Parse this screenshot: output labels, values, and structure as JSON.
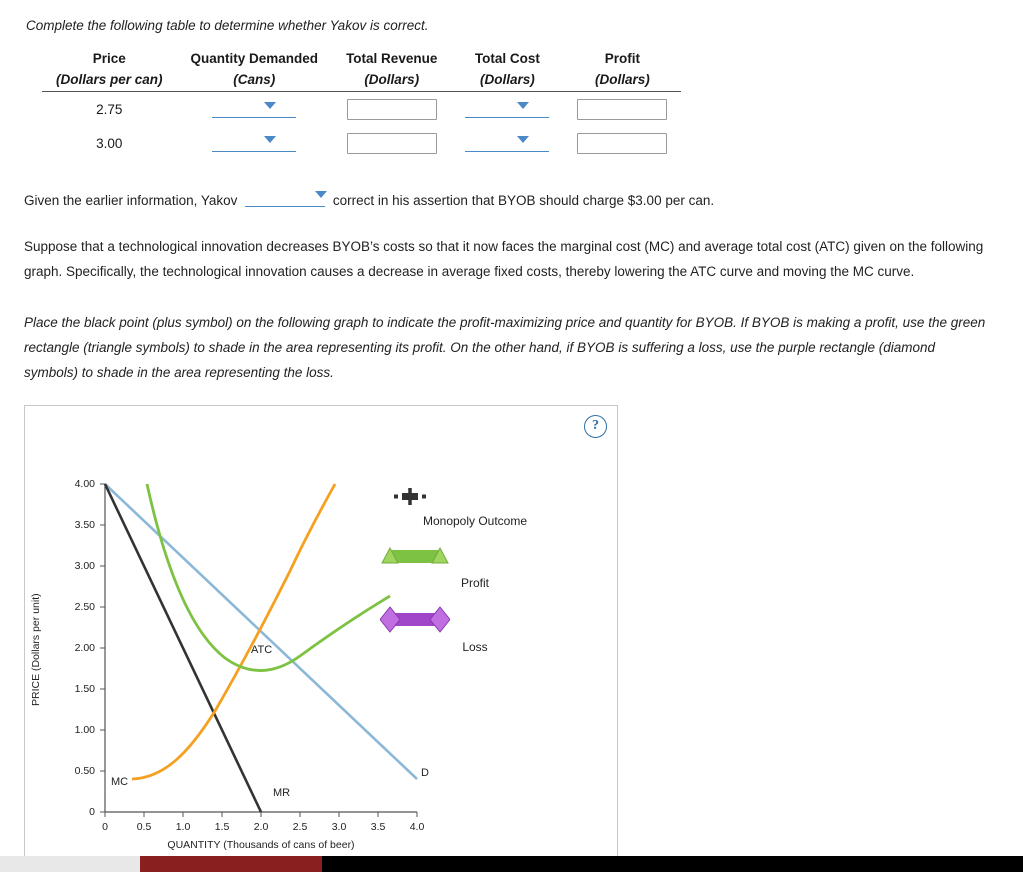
{
  "intro": "Complete the following table to determine whether Yakov is correct.",
  "table": {
    "headers": [
      {
        "title": "Price",
        "sub": "(Dollars per can)"
      },
      {
        "title": "Quantity Demanded",
        "sub": "(Cans)"
      },
      {
        "title": "Total Revenue",
        "sub": "(Dollars)"
      },
      {
        "title": "Total Cost",
        "sub": "(Dollars)"
      },
      {
        "title": "Profit",
        "sub": "(Dollars)"
      }
    ],
    "rows": [
      {
        "price": "2.75",
        "quantity": "",
        "total_revenue": "",
        "total_cost": "",
        "profit": ""
      },
      {
        "price": "3.00",
        "quantity": "",
        "total_revenue": "",
        "total_cost": "",
        "profit": ""
      }
    ]
  },
  "assertion": {
    "before": "Given the earlier information, Yakov",
    "dropdown_value": "",
    "after": "correct in his assertion that BYOB should charge $3.00 per can."
  },
  "paragraph1": "Suppose that a technological innovation decreases BYOB’s costs so that it now faces the marginal cost (MC) and average total cost (ATC) given on the following graph. Specifically, the technological innovation causes a decrease in average fixed costs, thereby lowering the ATC curve and moving the MC curve.",
  "paragraph2": "Place the black point (plus symbol) on the following graph to indicate the profit-maximizing price and quantity for BYOB. If BYOB is making a profit, use the green rectangle (triangle symbols) to shade in the area representing its profit. On the other hand, if BYOB is suffering a loss, use the purple rectangle (diamond symbols) to shade in the area representing the loss.",
  "graph_panel": {
    "help_label": "?",
    "legend": [
      {
        "name": "Monopoly Outcome",
        "color": "#333333",
        "symbol": "plus"
      },
      {
        "name": "Profit",
        "color": "#7dc242",
        "symbol": "triangle"
      },
      {
        "name": "Loss",
        "color": "#a046c8",
        "symbol": "diamond"
      }
    ]
  },
  "chart_data": {
    "type": "line",
    "title": "",
    "xlabel": "QUANTITY (Thousands of cans of beer)",
    "ylabel": "PRICE (Dollars per unit)",
    "xlim": [
      0,
      4.0
    ],
    "ylim": [
      0,
      4.0
    ],
    "xticks": [
      "0",
      "0.5",
      "1.0",
      "1.5",
      "2.0",
      "2.5",
      "3.0",
      "3.5",
      "4.0"
    ],
    "yticks": [
      "0",
      "0.50",
      "1.00",
      "1.50",
      "2.00",
      "2.50",
      "3.00",
      "3.50",
      "4.00"
    ],
    "grid": false,
    "series": [
      {
        "name": "D",
        "label": "D",
        "color": "#8cb8d8",
        "points": [
          [
            0,
            4.0
          ],
          [
            4.0,
            0.4
          ]
        ]
      },
      {
        "name": "MR",
        "label": "MR",
        "color": "#333333",
        "points": [
          [
            0,
            4.0
          ],
          [
            2.0,
            0.0
          ]
        ]
      },
      {
        "name": "MC",
        "label": "MC",
        "color": "#f5a020",
        "points": [
          [
            0.35,
            0.4
          ],
          [
            0.7,
            0.45
          ],
          [
            1.0,
            0.62
          ],
          [
            1.3,
            0.9
          ],
          [
            1.6,
            1.25
          ],
          [
            1.9,
            1.65
          ],
          [
            2.2,
            2.15
          ],
          [
            2.5,
            2.7
          ],
          [
            2.8,
            3.3
          ],
          [
            3.05,
            3.9
          ]
        ]
      },
      {
        "name": "ATC",
        "label": "ATC",
        "color": "#7dc242",
        "points": [
          [
            0.55,
            4.0
          ],
          [
            0.75,
            3.0
          ],
          [
            0.95,
            2.45
          ],
          [
            1.2,
            2.05
          ],
          [
            1.5,
            1.85
          ],
          [
            1.8,
            1.78
          ],
          [
            2.1,
            1.8
          ],
          [
            2.4,
            1.92
          ],
          [
            2.8,
            2.18
          ],
          [
            3.2,
            2.45
          ],
          [
            3.5,
            2.6
          ]
        ]
      }
    ]
  }
}
